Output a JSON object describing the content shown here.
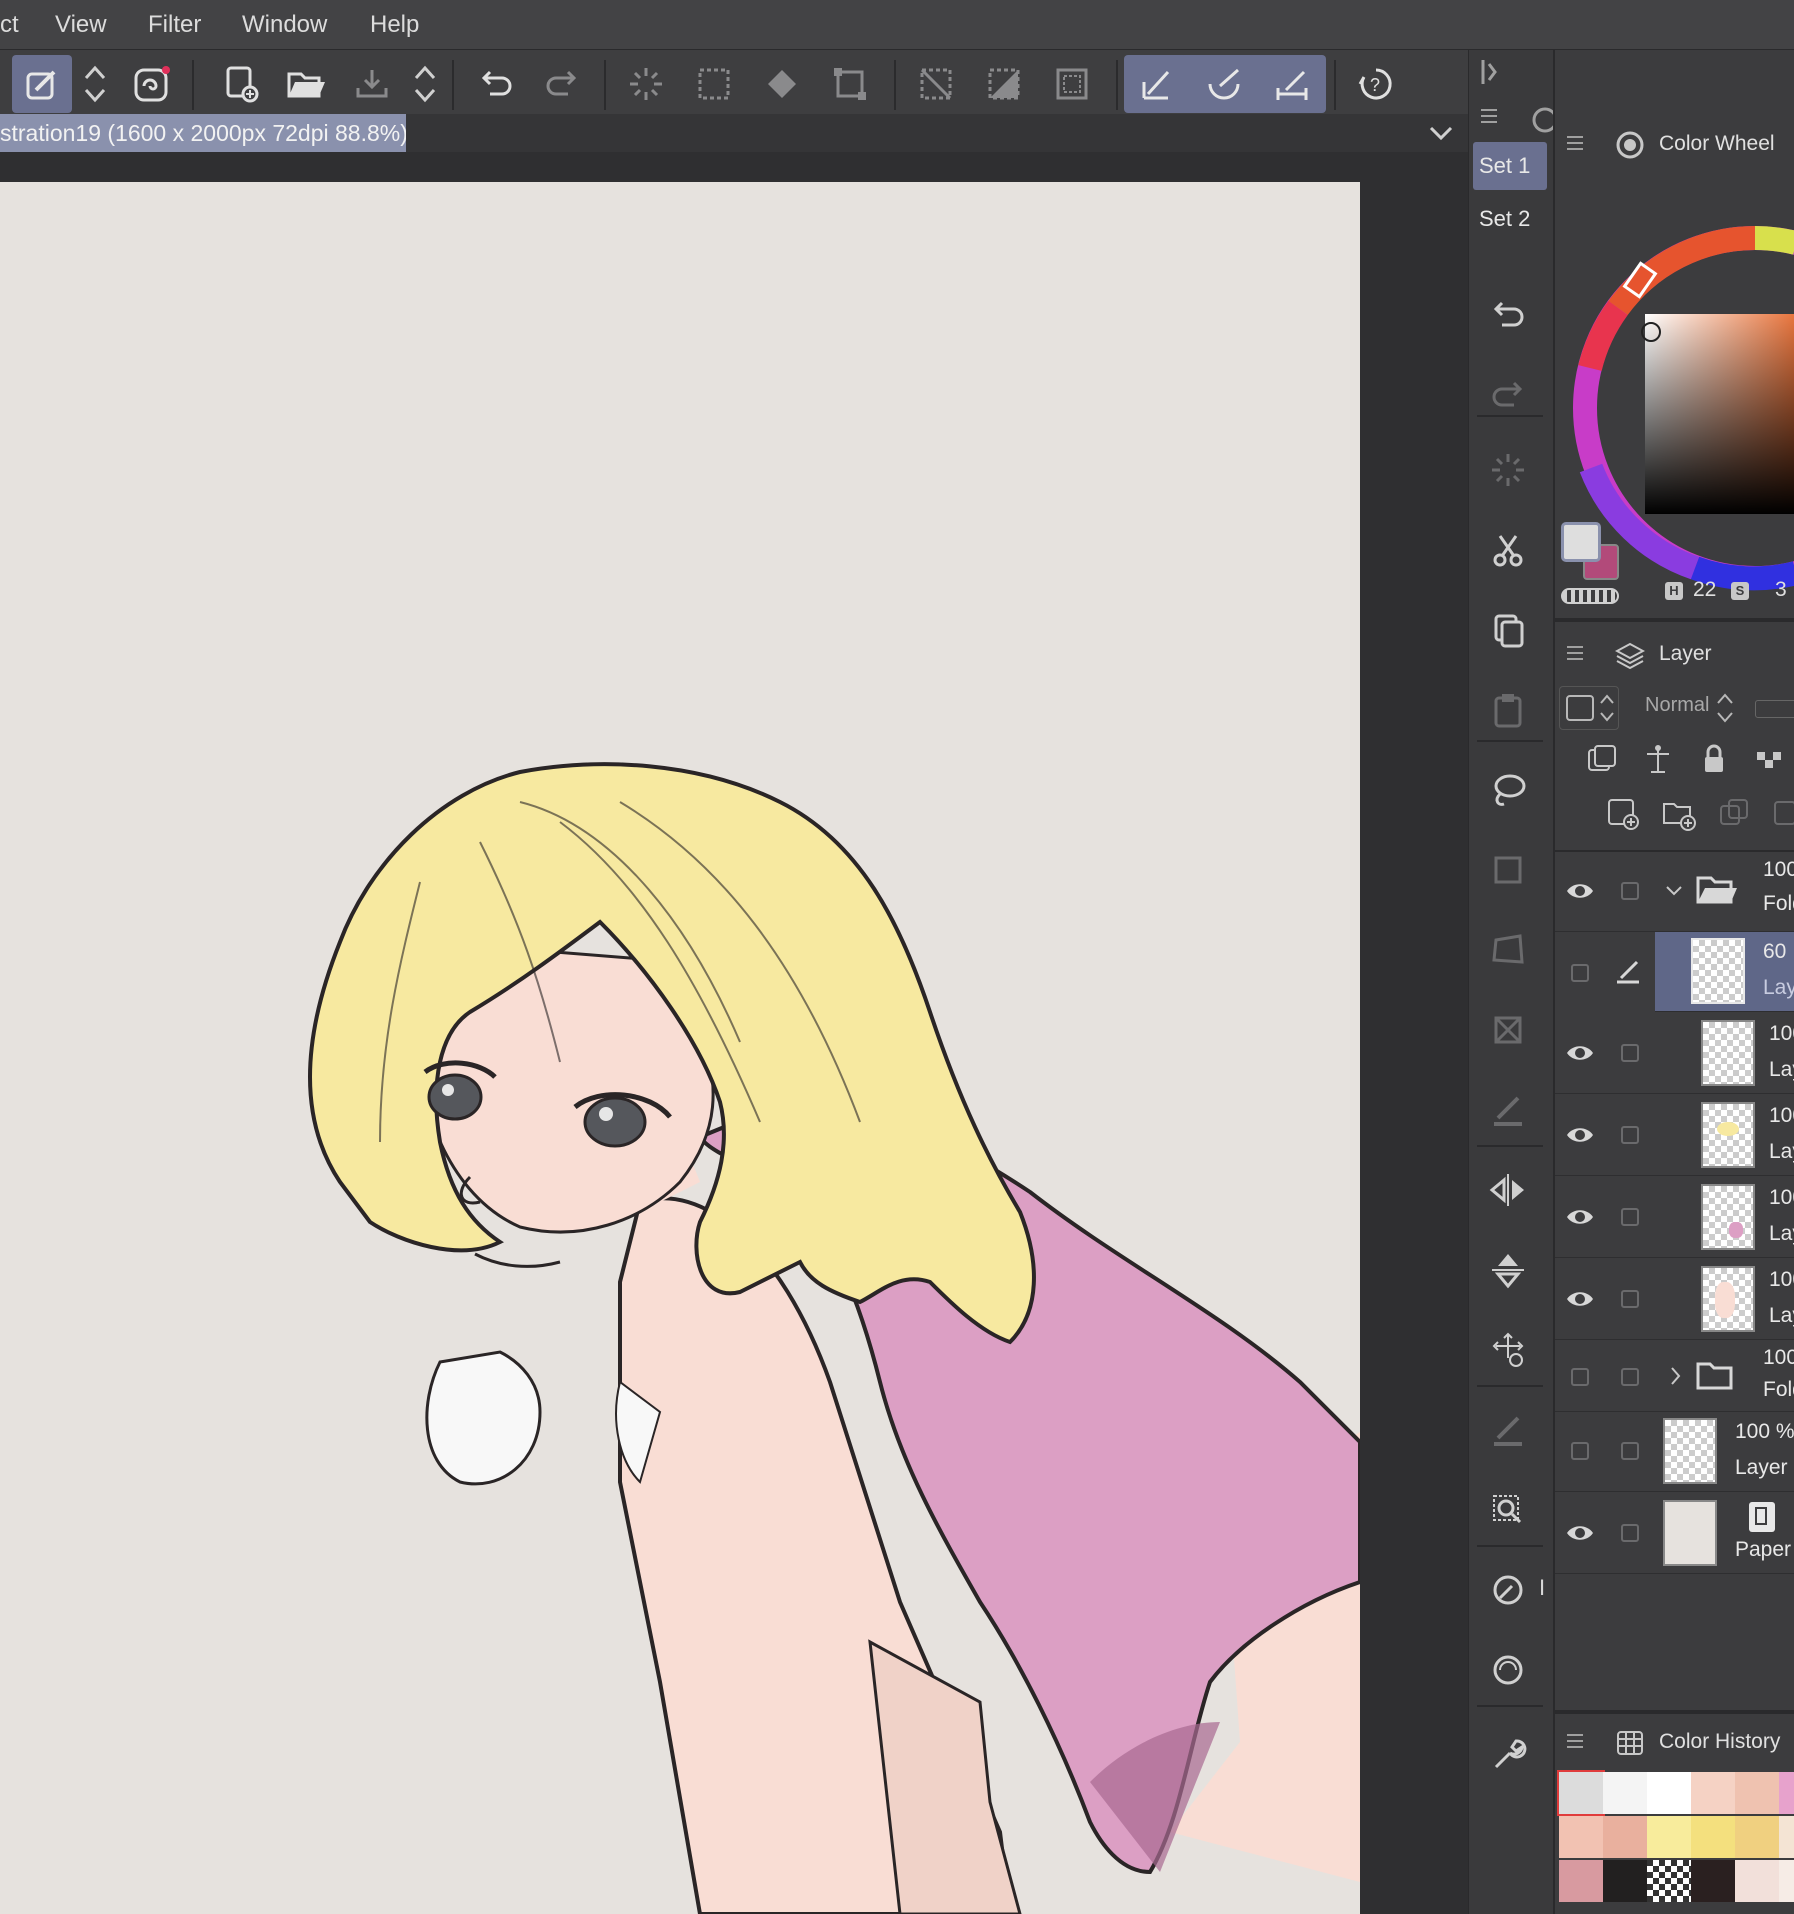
{
  "menu": [
    "ct",
    "View",
    "Filter",
    "Window",
    "Help"
  ],
  "document_tab": "stration19 (1600 x 2000px 72dpi 88.8%)",
  "side_sets": [
    "Set 1",
    "Set 2"
  ],
  "side_bottom_label": "I",
  "color_wheel": {
    "title": "Color Wheel",
    "h_value": "22",
    "s_value": "3",
    "main_color": "#dedede",
    "sub_color": "#b24a7a"
  },
  "layer_panel": {
    "title": "Layer",
    "blend_mode": "Normal",
    "layers": [
      {
        "opacity": "100",
        "name": "Fold",
        "type": "folder-open",
        "visible": true
      },
      {
        "opacity": "60",
        "name": "Lay",
        "type": "layer",
        "visible": false,
        "selected": true
      },
      {
        "opacity": "100",
        "name": "Lay",
        "type": "layer",
        "visible": true
      },
      {
        "opacity": "100",
        "name": "Lay",
        "type": "layer",
        "visible": true
      },
      {
        "opacity": "100",
        "name": "Lay",
        "type": "layer",
        "visible": true
      },
      {
        "opacity": "100",
        "name": "Lay",
        "type": "layer",
        "visible": true
      },
      {
        "opacity": "100",
        "name": "Fold",
        "type": "folder-closed",
        "visible": false
      },
      {
        "opacity": "100 %",
        "name": "Layer",
        "type": "layer",
        "visible": false
      },
      {
        "opacity": "",
        "name": "Paper",
        "type": "paper",
        "visible": true
      }
    ]
  },
  "color_history": {
    "title": "Color History",
    "swatches": [
      "#dcdcdc",
      "#f4f4f4",
      "#ffffff",
      "#f5d2c4",
      "#efc2b0",
      "#e7a2cc",
      "#f2c2b2",
      "#e9b09e",
      "#f8ec9c",
      "#f4e07e",
      "#f0d080",
      "#f4e4d4",
      "#d89aa0",
      "#222020",
      "checker",
      "#2a2020",
      "#f2e0da",
      "#f6ece6"
    ]
  },
  "colors": {
    "accent": "#6a7090",
    "hair": "#f7e9a0",
    "skin": "#f9ddd4",
    "shirt": "#dc9fc4",
    "paper": "#e6e2de",
    "line": "#2a2526"
  }
}
